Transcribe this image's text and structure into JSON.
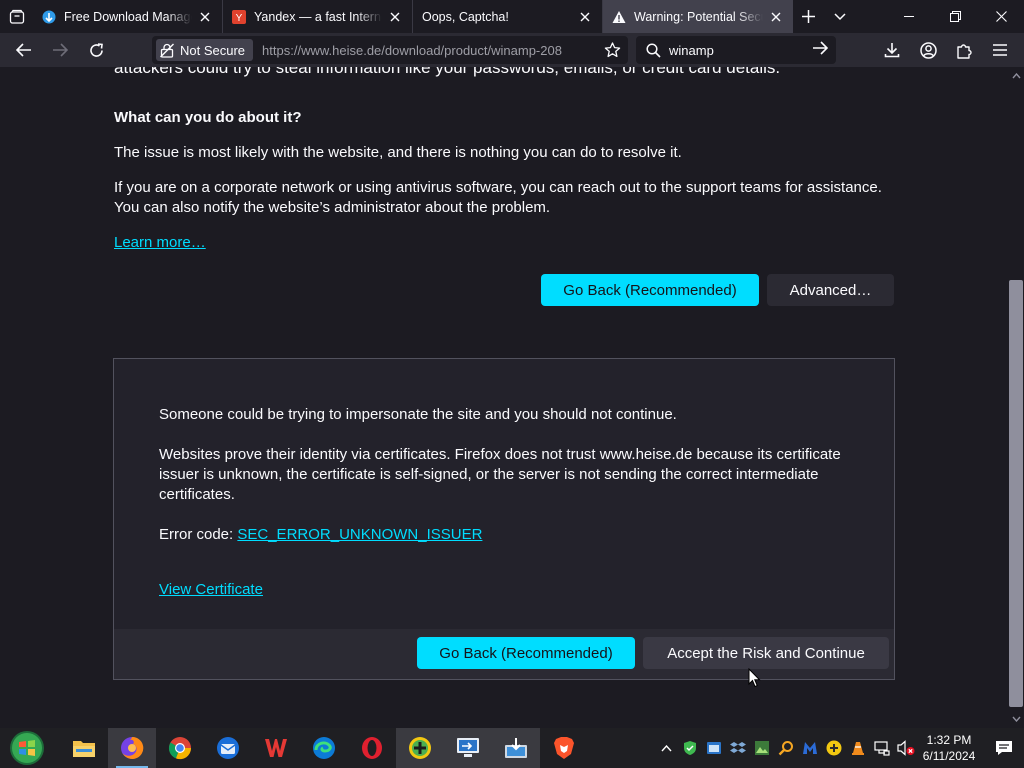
{
  "tabs": [
    {
      "title": "Free Download Manager",
      "favicon": "fdm-icon",
      "active": false
    },
    {
      "title": "Yandex — a fast Internet search",
      "favicon": "yandex-icon",
      "active": false
    },
    {
      "title": "Oops, Captcha!",
      "favicon": "",
      "active": false
    },
    {
      "title": "Warning: Potential Security Risk Ahead",
      "favicon": "warning-icon",
      "active": true
    }
  ],
  "navbar": {
    "not_secure_label": "Not Secure",
    "url": "https://www.heise.de/download/product/winamp-208",
    "search_text": "winamp"
  },
  "page": {
    "cut_off_line": "attackers could try to steal information like your passwords, emails, or credit card details.",
    "what_heading": "What can you do about it?",
    "para1": "The issue is most likely with the website, and there is nothing you can do to resolve it.",
    "para2_line1": "If you are on a corporate network or using antivirus software, you can reach out to the support teams for assistance.",
    "para2_line2": "You can also notify the website’s administrator about the problem.",
    "learn_more": "Learn more…",
    "go_back_label": "Go Back (Recommended)",
    "advanced_label": "Advanced…"
  },
  "advanced": {
    "impersonate": "Someone could be trying to impersonate the site and you should not continue.",
    "cert_line1": "Websites prove their identity via certificates. Firefox does not trust www.heise.de because its certificate",
    "cert_line2": "issuer is unknown, the certificate is self-signed, or the server is not sending the correct intermediate",
    "cert_line3": "certificates.",
    "error_code_label": "Error code:",
    "error_code": "SEC_ERROR_UNKNOWN_ISSUER",
    "view_certificate": "View Certificate",
    "go_back_label": "Go Back (Recommended)",
    "accept_label": "Accept the Risk and Continue"
  },
  "taskbar": {
    "apps": [
      "start-orb",
      "file-explorer",
      "firefox",
      "chrome",
      "thunderbird",
      "wps-office",
      "edge",
      "opera",
      "app-plus",
      "remote-desktop",
      "downloader",
      "brave"
    ],
    "time": "1:32 PM",
    "date": "6/11/2024"
  },
  "colors": {
    "accent": "#00ddff",
    "page_bg": "#1c1b22",
    "toolbar_bg": "#2b2a33"
  }
}
